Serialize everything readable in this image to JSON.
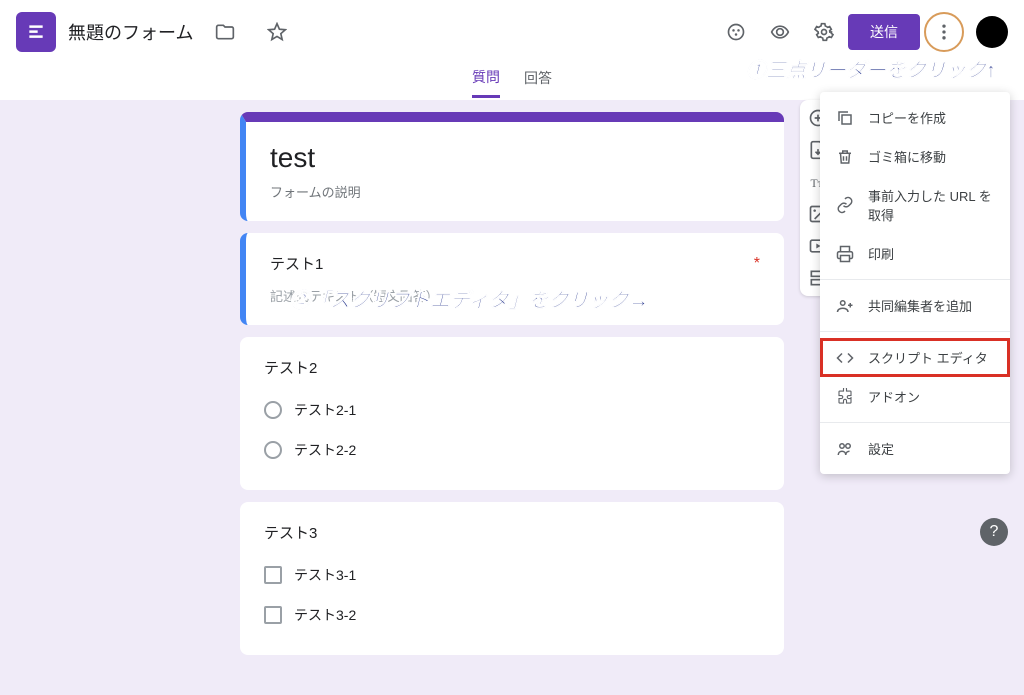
{
  "header": {
    "doc_title": "無題のフォーム",
    "send_label": "送信"
  },
  "tabs": {
    "questions": "質問",
    "responses": "回答"
  },
  "form": {
    "title": "test",
    "description_placeholder": "フォームの説明"
  },
  "q1": {
    "title": "テスト1",
    "hint": "記述式テキスト（短文回答）"
  },
  "q2": {
    "title": "テスト2",
    "opt1": "テスト2-1",
    "opt2": "テスト2-2"
  },
  "q3": {
    "title": "テスト3",
    "opt1": "テスト3-1",
    "opt2": "テスト3-2"
  },
  "menu": {
    "copy": "コピーを作成",
    "trash": "ゴミ箱に移動",
    "prefill": "事前入力した URL を取得",
    "print": "印刷",
    "collab": "共同編集者を追加",
    "script": "スクリプト エディタ",
    "addons": "アドオン",
    "settings": "設定"
  },
  "annotations": {
    "a1": "①三点リーダーをクリック↑",
    "a2": "②「スクリプトエディタ」をクリック→"
  }
}
